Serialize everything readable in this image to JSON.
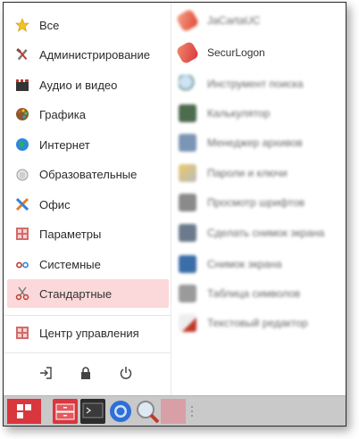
{
  "categories": [
    {
      "label": "Все",
      "icon": "star-icon",
      "active": false
    },
    {
      "label": "Администрирование",
      "icon": "tools-icon",
      "active": false
    },
    {
      "label": "Аудио и видео",
      "icon": "clapperboard-icon",
      "active": false
    },
    {
      "label": "Графика",
      "icon": "palette-icon",
      "active": false
    },
    {
      "label": "Интернет",
      "icon": "globe-icon",
      "active": false
    },
    {
      "label": "Образовательные",
      "icon": "education-icon",
      "active": false
    },
    {
      "label": "Офис",
      "icon": "office-icon",
      "active": false
    },
    {
      "label": "Параметры",
      "icon": "settings-panel-icon",
      "active": false
    },
    {
      "label": "Системные",
      "icon": "system-icon",
      "active": false
    },
    {
      "label": "Стандартные",
      "icon": "scissors-icon",
      "active": true
    }
  ],
  "control_center": {
    "label": "Центр управления",
    "icon": "control-center-icon"
  },
  "apps": [
    {
      "label": "JaCartaUC",
      "icon": "token-red-icon",
      "blurred": true
    },
    {
      "label": "SecurLogon",
      "icon": "token-red-icon",
      "blurred": false
    },
    {
      "label": "Инструмент поиска",
      "icon": "magnifier-icon",
      "blurred": true
    },
    {
      "label": "Калькулятор",
      "icon": "calculator-icon",
      "blurred": true
    },
    {
      "label": "Менеджер архивов",
      "icon": "archive-icon",
      "blurred": true
    },
    {
      "label": "Пароли и ключи",
      "icon": "keys-icon",
      "blurred": true
    },
    {
      "label": "Просмотр шрифтов",
      "icon": "font-viewer-icon",
      "blurred": true
    },
    {
      "label": "Сделать снимок экрана",
      "icon": "screenshot-icon",
      "blurred": true
    },
    {
      "label": "Снимок экрана",
      "icon": "camera-icon",
      "blurred": true
    },
    {
      "label": "Таблица символов",
      "icon": "charmap-icon",
      "blurred": true
    },
    {
      "label": "Текстовый редактор",
      "icon": "text-editor-icon",
      "blurred": true
    }
  ],
  "colors": {
    "active_bg": "#fbd8da",
    "accent_red": "#d9363e",
    "taskbar": "#c9c9c9"
  }
}
